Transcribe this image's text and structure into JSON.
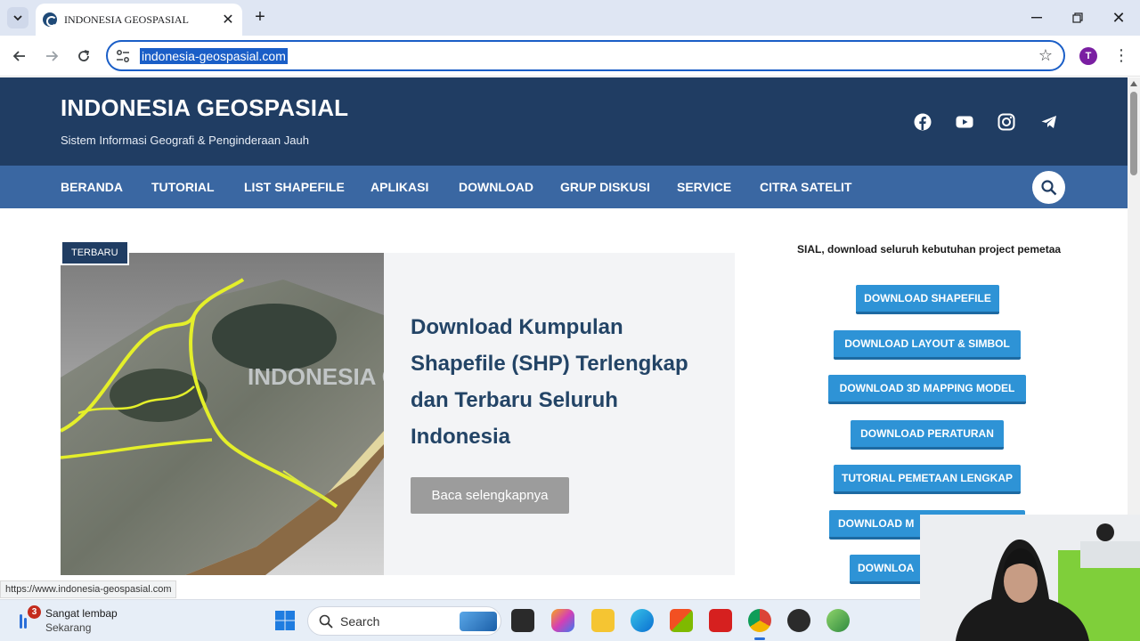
{
  "browser": {
    "tab_title": "INDONESIA GEOSPASIAL",
    "url": "indonesia-geospasial.com",
    "profile_initial": "T",
    "status_url": "https://www.indonesia-geospasial.com"
  },
  "site": {
    "title": "INDONESIA GEOSPASIAL",
    "tagline": "Sistem Informasi Geografi & Penginderaan Jauh",
    "social_icons": [
      "facebook-icon",
      "youtube-icon",
      "instagram-icon",
      "telegram-icon"
    ]
  },
  "nav": {
    "items": [
      "BERANDA",
      "TUTORIAL",
      "LIST SHAPEFILE",
      "APLIKASI",
      "DOWNLOAD",
      "GRUP DISKUSI",
      "SERVICE",
      "CITRA SATELIT"
    ]
  },
  "featured": {
    "badge": "TERBARU",
    "title": "Download Kumpulan Shapefile (SHP) Terlengkap dan Terbaru Seluruh Indonesia",
    "button": "Baca selengkapnya",
    "image_watermark": "INDONESIA GE"
  },
  "sidebar": {
    "marquee": "SIAL, download seluruh kebutuhan project pemetaa",
    "buttons": [
      "DOWNLOAD SHAPEFILE",
      "DOWNLOAD LAYOUT & SIMBOL",
      "DOWNLOAD 3D MAPPING MODEL",
      "DOWNLOAD PERATURAN",
      "TUTORIAL PEMETAAN LENGKAP",
      "DOWNLOAD M",
      "DOWNLOA"
    ]
  },
  "taskbar": {
    "weather_badge": "3",
    "weather_title": "Sangat lembap",
    "weather_sub": "Sekarang",
    "search_placeholder": "Search"
  },
  "colors": {
    "header_bg": "#203d63",
    "nav_bg": "#3a67a2",
    "button_blue": "#2e93d6",
    "url_highlight": "#1a5ec7"
  }
}
